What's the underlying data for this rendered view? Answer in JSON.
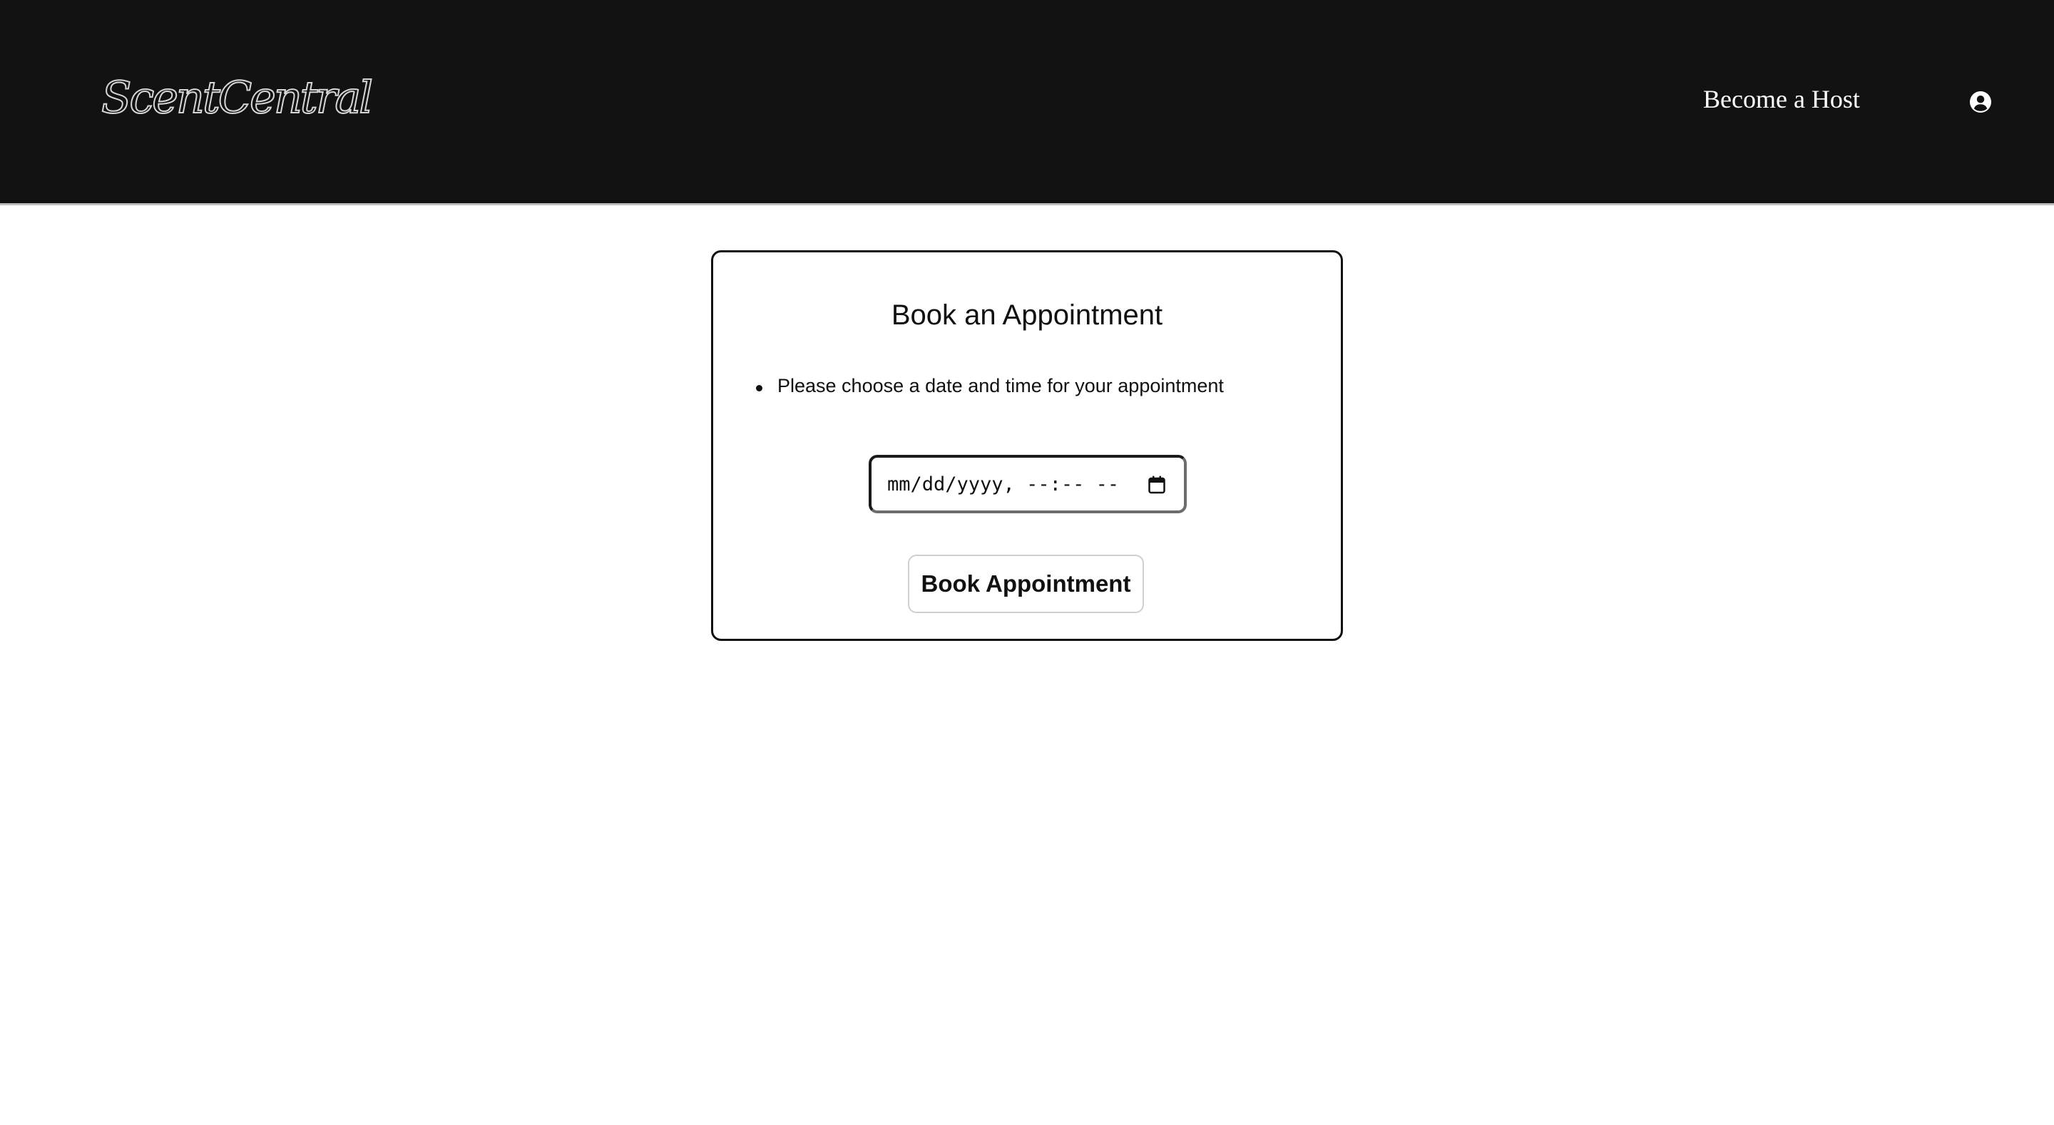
{
  "header": {
    "logo_text": "ScentCentral",
    "become_host_label": "Become a Host",
    "account_icon": "user-circle-icon"
  },
  "booking": {
    "title": "Book an Appointment",
    "instructions": [
      "Please choose a date and time for your appointment"
    ],
    "datetime_placeholder": "mm/dd/yyyy, --:-- --",
    "calendar_icon": "calendar-icon",
    "book_button_label": "Book Appointment"
  },
  "colors": {
    "header_bg": "#121212",
    "page_bg": "#ffffff",
    "text": "#111111"
  }
}
